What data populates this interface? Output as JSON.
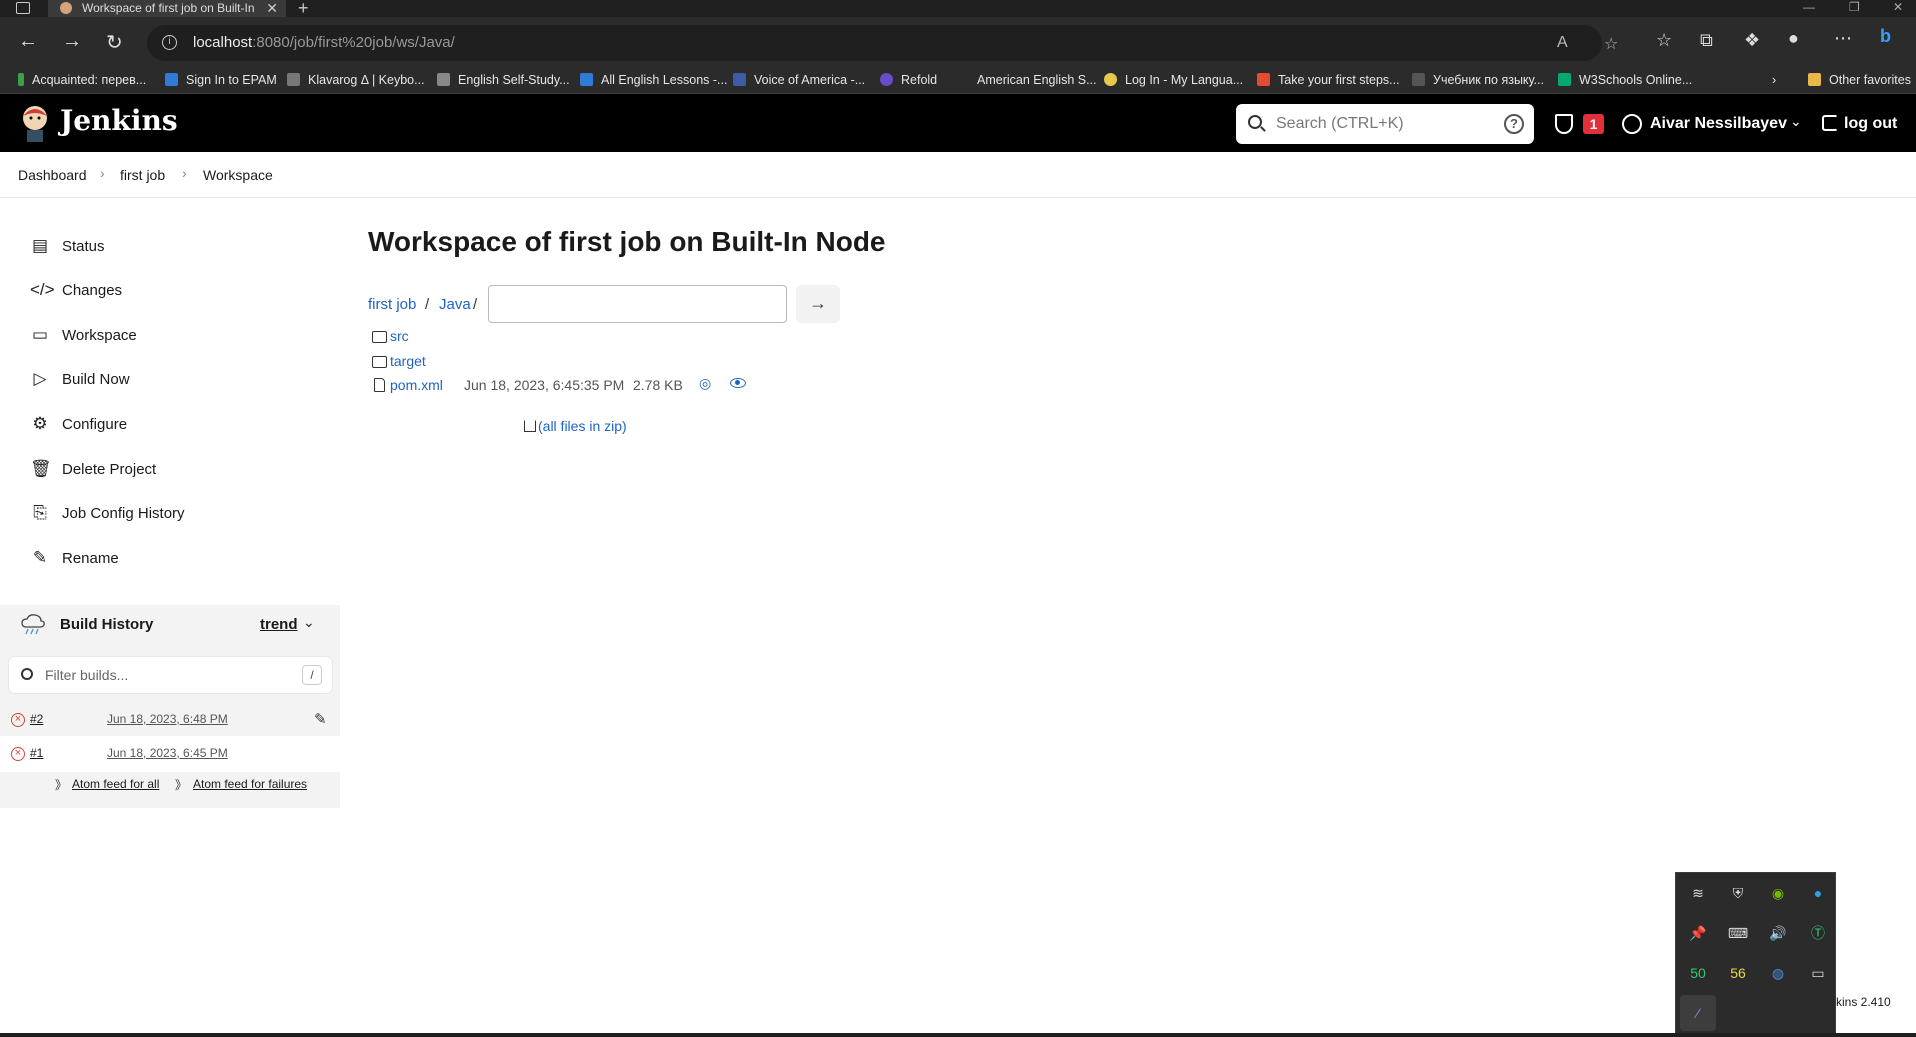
{
  "browser": {
    "tab_title": "Workspace of first job on Built-In",
    "url_host": "localhost",
    "url_rest": ":8080/job/first%20job/ws/Java/",
    "bookmarks": [
      "Acquainted: перев...",
      "Sign In to EPAM",
      "Klavarog Δ | Keybo...",
      "English Self-Study...",
      "All English Lessons -...",
      "Voice of America -...",
      "Refold",
      "American English S...",
      "Log In - My Langua...",
      "Take your first steps...",
      "Учебник по языку...",
      "W3Schools Online...",
      "Other favorites"
    ]
  },
  "header": {
    "logo_text": "Jenkins",
    "search_placeholder": "Search (CTRL+K)",
    "help": "?",
    "security_badge": "1",
    "user_name": "Aivar Nessilbayev",
    "logout": "log out"
  },
  "breadcrumbs": [
    "Dashboard",
    "first job",
    "Workspace"
  ],
  "sidebar": {
    "items": [
      {
        "label": "Status",
        "icon": "status-icon"
      },
      {
        "label": "Changes",
        "icon": "code-icon"
      },
      {
        "label": "Workspace",
        "icon": "folder-icon"
      },
      {
        "label": "Build Now",
        "icon": "play-icon"
      },
      {
        "label": "Configure",
        "icon": "gear-icon"
      },
      {
        "label": "Delete Project",
        "icon": "trash-icon"
      },
      {
        "label": "Job Config History",
        "icon": "config-history-icon"
      },
      {
        "label": "Rename",
        "icon": "pencil-icon"
      }
    ]
  },
  "build_history": {
    "title": "Build History",
    "trend": "trend",
    "filter_placeholder": "Filter builds...",
    "filter_shortcut": "/",
    "builds": [
      {
        "number": "#2",
        "date": "Jun 18, 2023, 6:48 PM",
        "status": "failed"
      },
      {
        "number": "#1",
        "date": "Jun 18, 2023, 6:45 PM",
        "status": "failed"
      }
    ],
    "feed_all": "Atom feed for all",
    "feed_failures": "Atom feed for failures"
  },
  "main": {
    "title": "Workspace of first job on Built-In Node",
    "path": [
      "first job",
      "Java"
    ],
    "path_sep": "/",
    "go_label": "→",
    "files": [
      {
        "name": "src",
        "type": "folder"
      },
      {
        "name": "target",
        "type": "folder"
      },
      {
        "name": "pom.xml",
        "type": "file",
        "date": "Jun 18, 2023, 6:45:35 PM",
        "size": "2.78 KB"
      }
    ],
    "zip_link": "(all files in zip)"
  },
  "tray": {
    "counter_a": "50",
    "counter_b": "56"
  },
  "footer": {
    "version": "kins 2.410"
  },
  "colors": {
    "link": "#1d64c2",
    "fail": "#d24939",
    "header_bg": "#000000"
  }
}
